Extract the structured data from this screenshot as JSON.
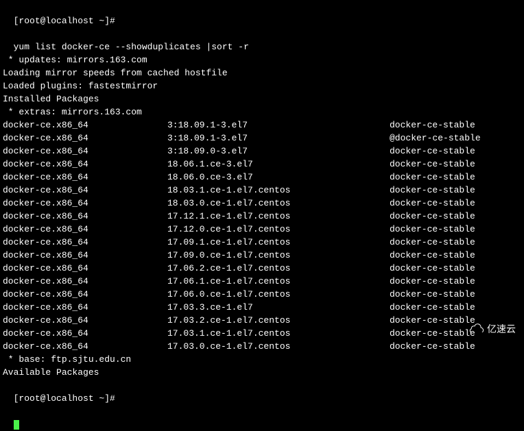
{
  "prompt": {
    "user_host": "[root@localhost ~]#",
    "command": "yum list docker-ce --showduplicates |sort -r"
  },
  "header_lines": [
    " * updates: mirrors.163.com",
    "Loading mirror speeds from cached hostfile",
    "Loaded plugins: fastestmirror",
    "Installed Packages",
    " * extras: mirrors.163.com"
  ],
  "packages": [
    {
      "name": "docker-ce.x86_64",
      "version": "3:18.09.1-3.el7",
      "repo": "docker-ce-stable"
    },
    {
      "name": "docker-ce.x86_64",
      "version": "3:18.09.1-3.el7",
      "repo": "@docker-ce-stable"
    },
    {
      "name": "docker-ce.x86_64",
      "version": "3:18.09.0-3.el7",
      "repo": "docker-ce-stable"
    },
    {
      "name": "docker-ce.x86_64",
      "version": "18.06.1.ce-3.el7",
      "repo": "docker-ce-stable"
    },
    {
      "name": "docker-ce.x86_64",
      "version": "18.06.0.ce-3.el7",
      "repo": "docker-ce-stable"
    },
    {
      "name": "docker-ce.x86_64",
      "version": "18.03.1.ce-1.el7.centos",
      "repo": "docker-ce-stable"
    },
    {
      "name": "docker-ce.x86_64",
      "version": "18.03.0.ce-1.el7.centos",
      "repo": "docker-ce-stable"
    },
    {
      "name": "docker-ce.x86_64",
      "version": "17.12.1.ce-1.el7.centos",
      "repo": "docker-ce-stable"
    },
    {
      "name": "docker-ce.x86_64",
      "version": "17.12.0.ce-1.el7.centos",
      "repo": "docker-ce-stable"
    },
    {
      "name": "docker-ce.x86_64",
      "version": "17.09.1.ce-1.el7.centos",
      "repo": "docker-ce-stable"
    },
    {
      "name": "docker-ce.x86_64",
      "version": "17.09.0.ce-1.el7.centos",
      "repo": "docker-ce-stable"
    },
    {
      "name": "docker-ce.x86_64",
      "version": "17.06.2.ce-1.el7.centos",
      "repo": "docker-ce-stable"
    },
    {
      "name": "docker-ce.x86_64",
      "version": "17.06.1.ce-1.el7.centos",
      "repo": "docker-ce-stable"
    },
    {
      "name": "docker-ce.x86_64",
      "version": "17.06.0.ce-1.el7.centos",
      "repo": "docker-ce-stable"
    },
    {
      "name": "docker-ce.x86_64",
      "version": "17.03.3.ce-1.el7",
      "repo": "docker-ce-stable"
    },
    {
      "name": "docker-ce.x86_64",
      "version": "17.03.2.ce-1.el7.centos",
      "repo": "docker-ce-stable"
    },
    {
      "name": "docker-ce.x86_64",
      "version": "17.03.1.ce-1.el7.centos",
      "repo": "docker-ce-stable"
    },
    {
      "name": "docker-ce.x86_64",
      "version": "17.03.0.ce-1.el7.centos",
      "repo": "docker-ce-stable"
    }
  ],
  "footer_lines": [
    " * base: ftp.sjtu.edu.cn",
    "Available Packages"
  ],
  "trailing_prompt": "[root@localhost ~]#",
  "watermark_text": "亿速云"
}
